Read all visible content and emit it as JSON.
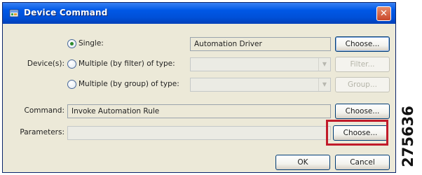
{
  "window": {
    "title": "Device Command",
    "close_glyph": "✕"
  },
  "device": {
    "label": "Device(s):",
    "single": {
      "label": "Single:",
      "value": "Automation Driver",
      "button": "Choose..."
    },
    "by_filter": {
      "label": "Multiple (by filter) of type:",
      "value": "",
      "button": "Filter..."
    },
    "by_group": {
      "label": "Multiple (by group) of type:",
      "value": "",
      "button": "Group..."
    }
  },
  "command": {
    "label": "Command:",
    "value": "Invoke Automation Rule",
    "button": "Choose..."
  },
  "parameters": {
    "label": "Parameters:",
    "value": "",
    "button": "Choose..."
  },
  "footer": {
    "ok": "OK",
    "cancel": "Cancel"
  },
  "figure_id": "275636",
  "icons": {
    "window": "window-app-icon",
    "dropdown": "chevron-down-icon"
  },
  "colors": {
    "title_bar": "#0058e6",
    "dialog_bg": "#ece9d8",
    "highlight_box": "#c11b2a"
  }
}
